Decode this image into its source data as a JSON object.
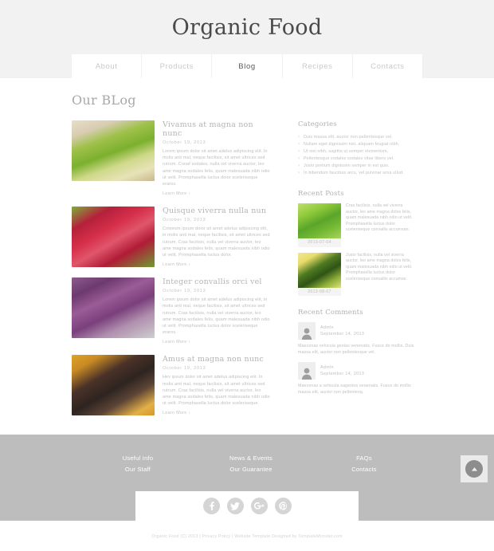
{
  "header": {
    "site_title": "Organic Food"
  },
  "nav": {
    "items": [
      {
        "label": "About",
        "active": false
      },
      {
        "label": "Products",
        "active": false
      },
      {
        "label": "Blog",
        "active": true
      },
      {
        "label": "Recipes",
        "active": false
      },
      {
        "label": "Contacts",
        "active": false
      }
    ]
  },
  "main": {
    "page_title": "Our BLog",
    "read_more_label": "Learn More",
    "read_more_arrow": "›",
    "posts": [
      {
        "title": "Vivamus at magna non nunc",
        "date": "October 19, 2013",
        "text": "Lorem ipsum dolor sit amet adelus adipiscing elit. In molis anti mal, neque facilisis, sit amet ultrices sed rutrum. Conaf sodales, nulla vel viverra auctor, leo ame magna sodales felis, quam malesuada nibh odio ut velit. Promphasella luctus dolor sceleriseque eraros.",
        "image": "apples"
      },
      {
        "title": "Quisque viverra nulla nun",
        "date": "October 19, 2013",
        "text": "Coteesm ipsum dolor sit amet adelus adipiscing elit, in molis anti mal, neque facilisis, sit amet ultrices sed rutrum. Cras facilisis, nulla vel viverra auctor, leo ame magna sodales felis, quam malesuada nibh odio ut velit. Promphasella luctus dolor.",
        "image": "radishes"
      },
      {
        "title": "Integer convallis orci vel",
        "date": "October 19, 2013",
        "text": "Lorem ipsum dolor sit amet adelus adipiscing elit, in molis anti mal, neque facilisis, sit amet ultrices sed rutrum. Cras facilisis, nulla vel viverra auctor, leo ame magna sodales felis, quam malesuada nibh odio ut velit. Promphasella luctus dolor sceleriseque eraros.",
        "image": "onions"
      },
      {
        "title": "Amus at magna non nunc",
        "date": "October 19, 2013",
        "text": "Hev ipsum dolor sit amet adelus adipiscing elit. In molis anti mal, neque facilisis, sit amet ultrices sed rutrum. Cras facilisis, nulla vel viverra auctor, leo ame magna sodales felis, quam malesuada nibh odio ut velit. Promphasella luctus dolor sceleriseque.",
        "image": "grapes"
      }
    ]
  },
  "sidebar": {
    "categories": {
      "title": "Categories",
      "items": [
        "Duis massa elit, auctor non pellentesque vel.",
        "Nullam eget dignissim nisi, aliquam feugiat nibh.",
        "Ut nisi nibh, sagittis ut semper elementum.",
        "Pellentesque sodales sodales vitae libero vel.",
        "Justo pretium dignissim semper in est quis.",
        "In bibendum faucibus arcu, vel pulvinar urna ullud."
      ]
    },
    "recent_posts": {
      "title": "Recent Posts",
      "items": [
        {
          "date": "2013-07-04",
          "text": "Cras facilisis, nulla vel viverra auctor, leo ame magna dolos felis, quam malesuada nibh odio ut velit. Promphasella luctus dolor sceleriseque convallis accumsan.",
          "image": "seedling"
        },
        {
          "date": "2013-08-07",
          "text": "Justo facilisis, nulla vel viverra auctor, leo ame magna dolos felis, quam malesuada nibh odio ut velit. Promphasella luctus dolor sceleriseque convallis accumse.",
          "image": "butterfly"
        }
      ]
    },
    "recent_comments": {
      "title": "Recent Comments",
      "items": [
        {
          "author": "Admin",
          "date": "September 14, 2013",
          "text": "Maecenas vehicula gestas venenatis. Fusce do mollis. Duis massa elit, auctor non pellentesque vel.",
          "avatar_icon": "user-avatar-icon"
        },
        {
          "author": "Admin",
          "date": "September 14, 2013",
          "text": "Maecenas a vehicula sagestos venenatis. Fusce do mollis massa elit, auctor non pellentesq.",
          "avatar_icon": "user-avatar-icon"
        }
      ]
    }
  },
  "footer": {
    "columns": [
      {
        "links": [
          "Useful Info",
          "Our Staff"
        ]
      },
      {
        "links": [
          "News & Events",
          "Our Guarantee"
        ]
      },
      {
        "links": [
          "FAQs",
          "Contacts"
        ]
      }
    ],
    "social": [
      {
        "name": "facebook",
        "glyph": "f"
      },
      {
        "name": "twitter",
        "glyph": "t"
      },
      {
        "name": "google-plus",
        "glyph": "g"
      },
      {
        "name": "pinterest",
        "glyph": "p"
      }
    ],
    "copyright": "Organic Food (C) 2013  |  Privacy Policy | Website Template Designed by TemplateMonster.com",
    "to_top_label": "▲"
  },
  "colors": {
    "header_bg": "#f2f2f2",
    "footer_bg": "#bdbdbd",
    "text_muted": "#c0c0c0",
    "nav_active": "#5a5a5a",
    "to_top_bg": "#8d8d8d"
  }
}
